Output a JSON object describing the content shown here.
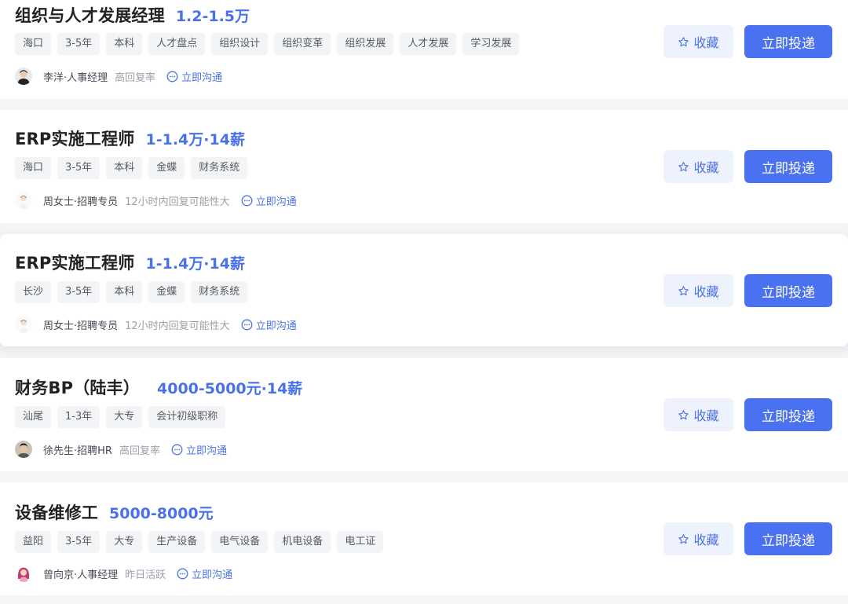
{
  "jobs": [
    {
      "title": "组织与人才发展经理",
      "salary": "1.2-1.5万",
      "tags": [
        "海口",
        "3-5年",
        "本科",
        "人才盘点",
        "组织设计",
        "组织变革",
        "组织发展",
        "人才发展",
        "学习发展"
      ],
      "recruiter": "李洋·人事经理",
      "activity": "高回复率",
      "avatar": "dark-hair-male-avatar",
      "chat_label": "立即沟通",
      "favorite_label": "收藏",
      "apply_label": "立即投递"
    },
    {
      "title": "ERP实施工程师",
      "salary": "1-1.4万·14薪",
      "tags": [
        "海口",
        "3-5年",
        "本科",
        "金蝶",
        "财务系统"
      ],
      "recruiter": "周女士·招聘专员",
      "activity": "12小时内回复可能性大",
      "avatar": "light-female-avatar",
      "chat_label": "立即沟通",
      "favorite_label": "收藏",
      "apply_label": "立即投递"
    },
    {
      "title": "ERP实施工程师",
      "salary": "1-1.4万·14薪",
      "tags": [
        "长沙",
        "3-5年",
        "本科",
        "金蝶",
        "财务系统"
      ],
      "recruiter": "周女士·招聘专员",
      "activity": "12小时内回复可能性大",
      "avatar": "light-female-avatar",
      "chat_label": "立即沟通",
      "favorite_label": "收藏",
      "apply_label": "立即投递"
    },
    {
      "title": "财务BP（陆丰）",
      "salary": "4000-5000元·14薪",
      "tags": [
        "汕尾",
        "1-3年",
        "大专",
        "会计初级职称"
      ],
      "recruiter": "徐先生·招聘HR",
      "activity": "高回复率",
      "avatar": "photo-male-avatar",
      "chat_label": "立即沟通",
      "favorite_label": "收藏",
      "apply_label": "立即投递"
    },
    {
      "title": "设备维修工",
      "salary": "5000-8000元",
      "tags": [
        "益阳",
        "3-5年",
        "大专",
        "生产设备",
        "电气设备",
        "机电设备",
        "电工证"
      ],
      "recruiter": "曾向京·人事经理",
      "activity": "昨日活跃",
      "avatar": "cartoon-female-avatar",
      "chat_label": "立即沟通",
      "favorite_label": "收藏",
      "apply_label": "立即投递"
    }
  ],
  "colors": {
    "accent": "#4a72f0",
    "salary": "#4a72e8",
    "favorite_bg": "#eef2fd",
    "tag_bg": "#f3f4f6",
    "page_bg": "#f4f5f7"
  }
}
